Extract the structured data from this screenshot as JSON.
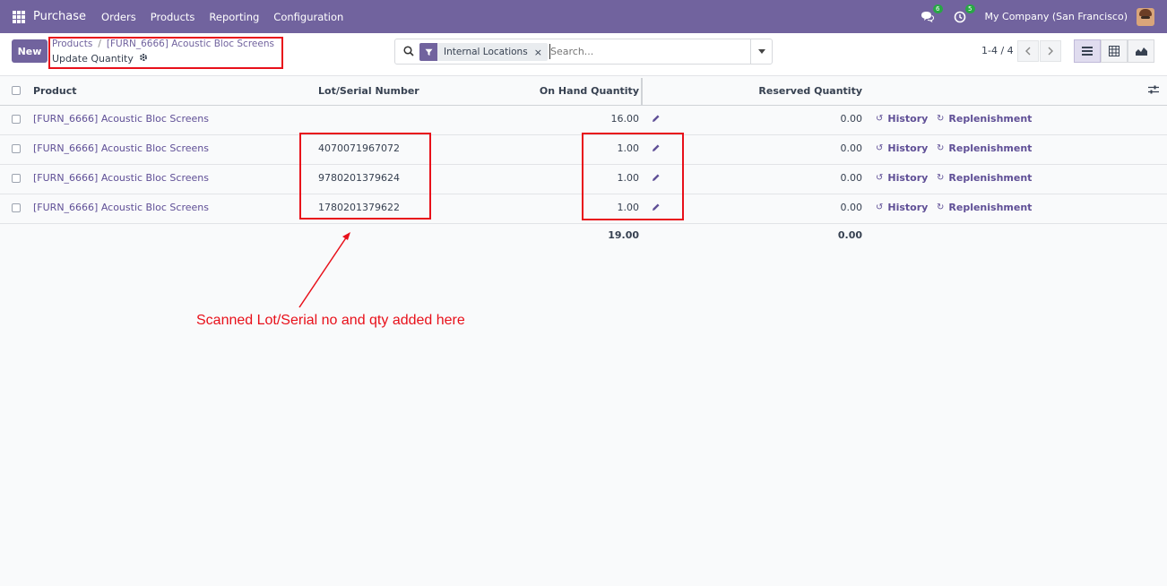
{
  "navbar": {
    "app_name": "Purchase",
    "menu": [
      "Orders",
      "Products",
      "Reporting",
      "Configuration"
    ],
    "chat_badge": "6",
    "activity_badge": "5",
    "company": "My Company (San Francisco)"
  },
  "control": {
    "new_label": "New",
    "breadcrumb": [
      "Products",
      "[FURN_6666] Acoustic Bloc Screens"
    ],
    "breadcrumb_sep": "/",
    "subtitle": "Update Quantity",
    "facet_label": "Internal Locations",
    "facet_close": "×",
    "search_placeholder": "Search...",
    "pager": "1-4 / 4"
  },
  "table": {
    "columns": [
      "Product",
      "Lot/Serial Number",
      "On Hand Quantity",
      "Reserved Quantity"
    ],
    "history_label": "History",
    "replenishment_label": "Replenishment",
    "rows": [
      {
        "product": "[FURN_6666] Acoustic Bloc Screens",
        "lot": "",
        "qty": "16.00",
        "reserved": "0.00"
      },
      {
        "product": "[FURN_6666] Acoustic Bloc Screens",
        "lot": "4070071967072",
        "qty": "1.00",
        "reserved": "0.00"
      },
      {
        "product": "[FURN_6666] Acoustic Bloc Screens",
        "lot": "9780201379624",
        "qty": "1.00",
        "reserved": "0.00"
      },
      {
        "product": "[FURN_6666] Acoustic Bloc Screens",
        "lot": "1780201379622",
        "qty": "1.00",
        "reserved": "0.00"
      }
    ],
    "total_qty": "19.00",
    "total_reserved": "0.00"
  },
  "annotation": {
    "text": "Scanned Lot/Serial no and qty added here",
    "color": "#e8101a"
  },
  "colors": {
    "brand": "#71639e",
    "link": "#5f4f96"
  }
}
